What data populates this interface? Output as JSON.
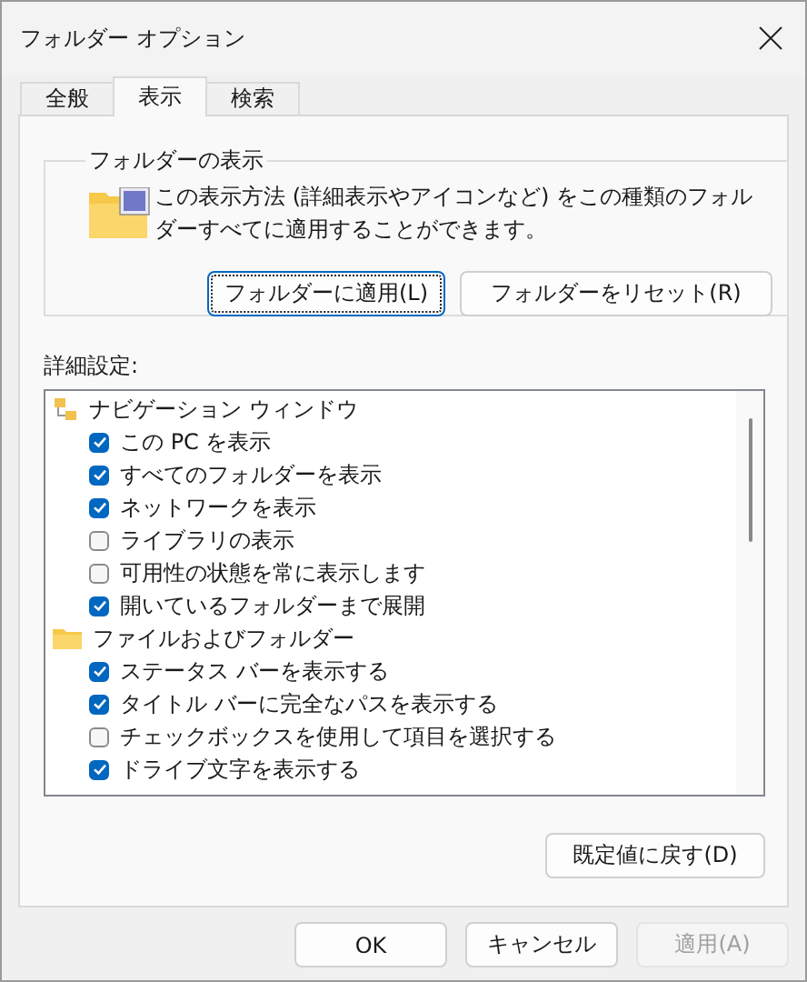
{
  "window": {
    "title": "フォルダー オプション"
  },
  "tabs": [
    {
      "label": "全般",
      "selected": false
    },
    {
      "label": "表示",
      "selected": true
    },
    {
      "label": "検索",
      "selected": false
    }
  ],
  "folder_view": {
    "title": "フォルダーの表示",
    "description": "この表示方法 (詳細表示やアイコンなど) をこの種類のフォルダーすべてに適用することができます。",
    "buttons": [
      {
        "label": "フォルダーに適用(L)",
        "focused": true
      },
      {
        "label": "フォルダーをリセット(R)",
        "focused": false
      }
    ]
  },
  "advanced": {
    "label": "詳細設定:",
    "tree": [
      {
        "kind": "nav",
        "label": "ナビゲーション ウィンドウ",
        "children": [
          {
            "label": "この PC を表示",
            "checked": true
          },
          {
            "label": "すべてのフォルダーを表示",
            "checked": true
          },
          {
            "label": "ネットワークを表示",
            "checked": true
          },
          {
            "label": "ライブラリの表示",
            "checked": false
          },
          {
            "label": "可用性の状態を常に表示します",
            "checked": false
          },
          {
            "label": "開いているフォルダーまで展開",
            "checked": true
          }
        ]
      },
      {
        "kind": "folder",
        "label": "ファイルおよびフォルダー",
        "children": [
          {
            "label": "ステータス バーを表示する",
            "checked": true
          },
          {
            "label": "タイトル バーに完全なパスを表示する",
            "checked": true
          },
          {
            "label": "チェックボックスを使用して項目を選択する",
            "checked": false
          },
          {
            "label": "ドライブ文字を表示する",
            "checked": true
          }
        ]
      }
    ],
    "restore_button": "既定値に戻す(D)"
  },
  "footer_buttons": [
    {
      "label": "OK",
      "disabled": false
    },
    {
      "label": "キャンセル",
      "disabled": false
    },
    {
      "label": "適用(A)",
      "disabled": true
    }
  ]
}
